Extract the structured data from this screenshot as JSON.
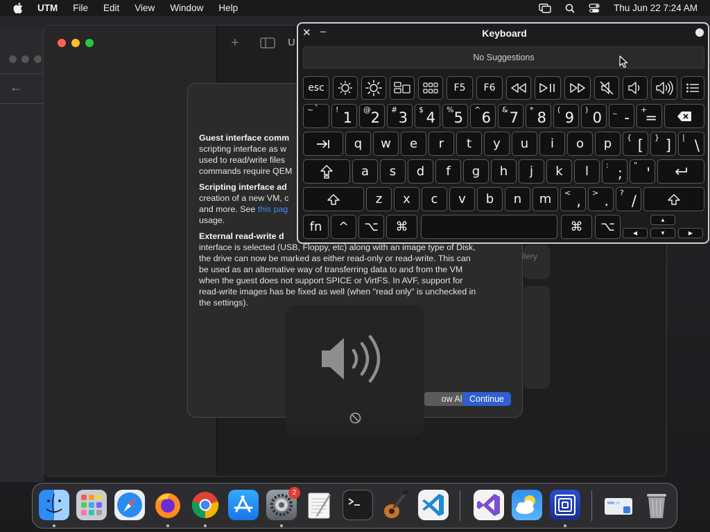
{
  "menubar": {
    "app_name": "UTM",
    "items": [
      "File",
      "Edit",
      "View",
      "Window",
      "Help"
    ],
    "datetime": "Thu Jun 22  7:24 AM"
  },
  "background_window": {
    "title_partial": "U"
  },
  "dialog": {
    "paragraphs": [
      {
        "heading": "Guest interface comm",
        "lines": [
          "scripting interface as w",
          "used to read/write files",
          "commands require QEM"
        ]
      },
      {
        "heading": "Scripting interface ad",
        "lines": [
          "creation of a new VM, c",
          "and more. See "
        ],
        "link": "this pag",
        "tail": "usage."
      },
      {
        "heading": "External read-write d",
        "lines": [
          "interface is selected (USB, Floppy, etc) along with an image type of Disk,",
          "the drive can now be marked as either read-only or read-write. This can",
          "be used as an alternative way of transferring data to and from the VM",
          "when the guest does not support SPICE or VirtFS. In AVF, support for",
          "read-write images has be fixed as well (when \"read only\" is unchecked in",
          "the settings)."
        ]
      }
    ],
    "show_all_label": "ow All",
    "continue_label": "Continue"
  },
  "right_panel": {
    "gallery_partial": "llery"
  },
  "keyboard": {
    "title": "Keyboard",
    "suggestions": "No Suggestions",
    "fn_row": {
      "esc": "esc",
      "f5": "F5",
      "f6": "F6"
    },
    "number_row": [
      {
        "top": "~",
        "bot": "`"
      },
      {
        "top": "!",
        "bot": "1"
      },
      {
        "top": "@",
        "bot": "2"
      },
      {
        "top": "#",
        "bot": "3"
      },
      {
        "top": "$",
        "bot": "4"
      },
      {
        "top": "%",
        "bot": "5"
      },
      {
        "top": "^",
        "bot": "6"
      },
      {
        "top": "&",
        "bot": "7"
      },
      {
        "top": "*",
        "bot": "8"
      },
      {
        "top": "(",
        "bot": "9"
      },
      {
        "top": ")",
        "bot": "0"
      },
      {
        "top": "_",
        "bot": "-"
      },
      {
        "top": "+",
        "bot": "="
      }
    ],
    "row_q": [
      "q",
      "w",
      "e",
      "r",
      "t",
      "y",
      "u",
      "i",
      "o",
      "p"
    ],
    "row_q_sym": [
      {
        "top": "{",
        "bot": "["
      },
      {
        "top": "}",
        "bot": "]"
      },
      {
        "top": "|",
        "bot": "\\"
      }
    ],
    "row_a": [
      "a",
      "s",
      "d",
      "f",
      "g",
      "h",
      "j",
      "k",
      "l"
    ],
    "row_a_sym": [
      {
        "top": ":",
        "bot": ";"
      },
      {
        "top": "\"",
        "bot": "'"
      }
    ],
    "row_z": [
      "z",
      "x",
      "c",
      "v",
      "b",
      "n",
      "m"
    ],
    "row_z_sym": [
      {
        "top": "<",
        "bot": ","
      },
      {
        "top": ">",
        "bot": "."
      },
      {
        "top": "?",
        "bot": "/"
      }
    ],
    "bottom": {
      "fn": "fn",
      "ctrl": "^",
      "opt": "⌥",
      "cmd": "⌘"
    }
  },
  "dock": {
    "system_settings_badge": "2",
    "apps": [
      "Finder",
      "Launchpad",
      "Safari",
      "Firefox",
      "Chrome",
      "App Store",
      "System Settings",
      "TextEdit",
      "Terminal",
      "GarageBand",
      "VS Code",
      "Visual Studio",
      "Weather",
      "UTM",
      "Preview",
      "Trash"
    ]
  },
  "colors": {
    "accent": "#2f5fd0",
    "link": "#3b8cf5",
    "badge": "#e23b30"
  }
}
